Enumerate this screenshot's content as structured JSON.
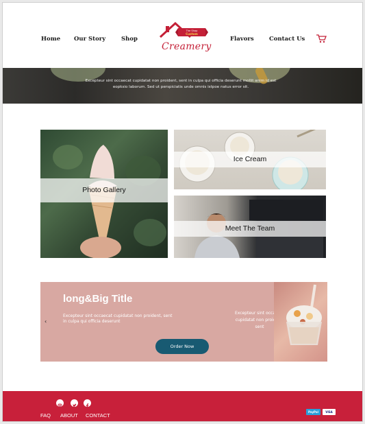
{
  "nav": {
    "home": "Home",
    "story": "Our Story",
    "shop": "Shop",
    "flavors": "Flavors",
    "contact": "Contact Us"
  },
  "logo": {
    "tag": "The Shop Custom",
    "script": "Creamery",
    "brand_color": "#c42037"
  },
  "banner": {
    "text": "Excepteur sint occaecat cupidatat non proident, sent in culpa qui officia deserunt mollit anim id est eopksio laborum. Sed ut perspiciatis unde omnis istpoe natus error sit."
  },
  "tiles": {
    "gallery": "Photo Gallery",
    "ice_cream": "Ice Cream",
    "team": "Meet The Team"
  },
  "promo": {
    "title": "long&Big Title",
    "body": "Excepteur sint occaecat cupidatat non proident, sent in culpa qui officia deserunt",
    "side_text": "Excepteur sint occaecat cupidatat non proident, sent",
    "button": "Order Now",
    "prev_icon": "‹",
    "bg_color": "#d8a8a2",
    "button_color": "#185a72"
  },
  "footer": {
    "links": [
      "FAQ",
      "ABOUT",
      "CONTACT"
    ],
    "social_icons": [
      "instagram-icon",
      "twitter-icon",
      "facebook-icon"
    ],
    "payments": [
      "PayPal",
      "VISA"
    ],
    "bg_color": "#c8203a"
  }
}
